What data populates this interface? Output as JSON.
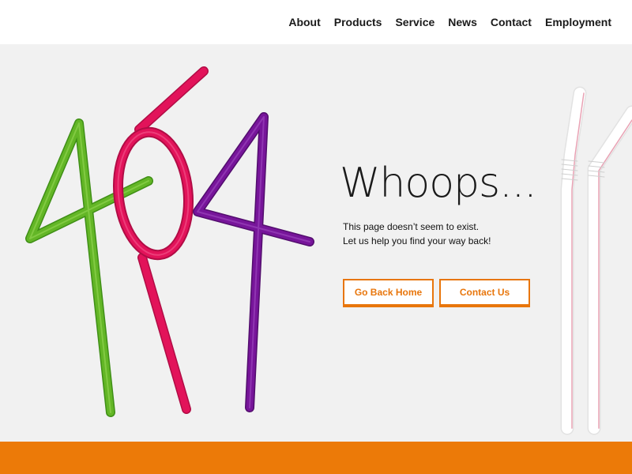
{
  "nav": {
    "items": [
      {
        "label": "About"
      },
      {
        "label": "Products"
      },
      {
        "label": "Service"
      },
      {
        "label": "News"
      },
      {
        "label": "Contact"
      },
      {
        "label": "Employment"
      }
    ]
  },
  "error": {
    "illustration_icon": "404-straws-icon",
    "headline": "Whoops...",
    "message_line1": "This page doesn’t seem to exist.",
    "message_line2": "Let us help you find your way back!"
  },
  "buttons": {
    "home_label": "Go Back Home",
    "contact_label": "Contact Us"
  },
  "colors": {
    "accent": "#ec7a08",
    "green_straw": "#63b626",
    "pink_straw": "#e2135a",
    "purple_straw": "#77159a",
    "background": "#f1f1f1"
  }
}
